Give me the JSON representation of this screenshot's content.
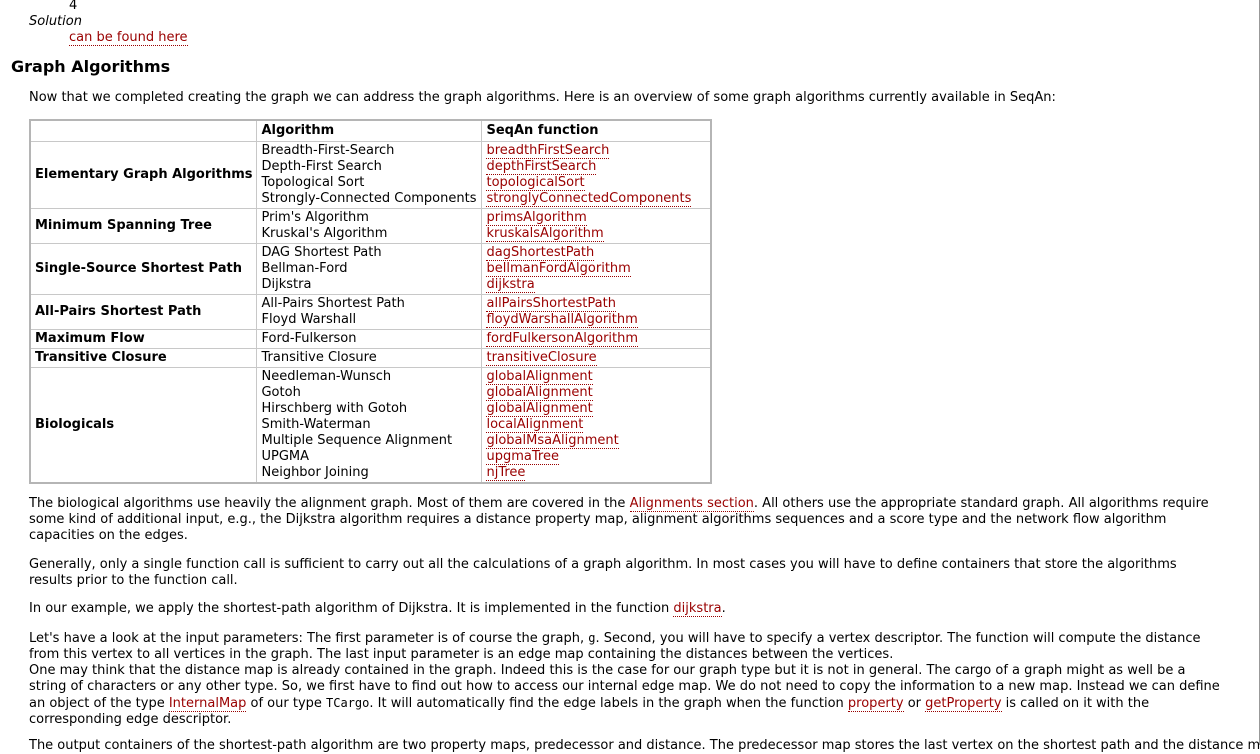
{
  "top_number": "4",
  "solution_label": "Solution",
  "solution_link": "can be found here",
  "section_title": "Graph Algorithms",
  "intro": "Now that we completed creating the graph we can address the graph algorithms. Here is an overview of some graph algorithms currently available in SeqAn:",
  "table": {
    "headers": [
      "",
      "Algorithm",
      "SeqAn function"
    ],
    "groups": [
      {
        "category": "Elementary Graph Algorithms",
        "rows": [
          {
            "algorithm": "Breadth-First-Search",
            "function": "breadthFirstSearch"
          },
          {
            "algorithm": "Depth-First Search",
            "function": "depthFirstSearch"
          },
          {
            "algorithm": "Topological Sort",
            "function": "topologicalSort"
          },
          {
            "algorithm": "Strongly-Connected Components",
            "function": "stronglyConnectedComponents"
          }
        ]
      },
      {
        "category": "Minimum Spanning Tree",
        "rows": [
          {
            "algorithm": "Prim's Algorithm",
            "function": "primsAlgorithm"
          },
          {
            "algorithm": "Kruskal's Algorithm",
            "function": "kruskalsAlgorithm"
          }
        ]
      },
      {
        "category": "Single-Source Shortest Path",
        "rows": [
          {
            "algorithm": "DAG Shortest Path",
            "function": "dagShortestPath"
          },
          {
            "algorithm": "Bellman-Ford",
            "function": "bellmanFordAlgorithm"
          },
          {
            "algorithm": "Dijkstra",
            "function": "dijkstra"
          }
        ]
      },
      {
        "category": "All-Pairs Shortest Path",
        "rows": [
          {
            "algorithm": "All-Pairs Shortest Path",
            "function": "allPairsShortestPath"
          },
          {
            "algorithm": "Floyd Warshall",
            "function": "floydWarshallAlgorithm"
          }
        ]
      },
      {
        "category": "Maximum Flow",
        "rows": [
          {
            "algorithm": "Ford-Fulkerson",
            "function": "fordFulkersonAlgorithm"
          }
        ]
      },
      {
        "category": "Transitive Closure",
        "rows": [
          {
            "algorithm": "Transitive Closure",
            "function": "transitiveClosure"
          }
        ]
      },
      {
        "category": "Biologicals",
        "rows": [
          {
            "algorithm": "Needleman-Wunsch",
            "function": "globalAlignment"
          },
          {
            "algorithm": "Gotoh",
            "function": "globalAlignment"
          },
          {
            "algorithm": "Hirschberg with Gotoh",
            "function": "globalAlignment"
          },
          {
            "algorithm": "Smith-Waterman",
            "function": "localAlignment"
          },
          {
            "algorithm": "Multiple Sequence Alignment",
            "function": "globalMsaAlignment"
          },
          {
            "algorithm": "UPGMA",
            "function": "upgmaTree"
          },
          {
            "algorithm": "Neighbor Joining",
            "function": "njTree"
          }
        ]
      }
    ]
  },
  "para1": {
    "before": "The biological algorithms use heavily the alignment graph. Most of them are covered in the ",
    "link": "Alignments section",
    "after": ". All others use the appropriate standard graph. All algorithms require some kind of additional input, e.g., the Dijkstra algorithm requires a distance property map, alignment algorithms sequences and a score type and the network flow algorithm capacities on the edges."
  },
  "para2": "Generally, only a single function call is sufficient to carry out all the calculations of a graph algorithm. In most cases you will have to define containers that store the algorithms results prior to the function call.",
  "para3": {
    "before": "In our example, we apply the shortest-path algorithm of Dijkstra. It is implemented in the function ",
    "link": "dijkstra",
    "after": "."
  },
  "para4": {
    "s1": "Let's have a look at the input parameters: The first parameter is of course the graph, ",
    "code1": "g",
    "s2": ". Second, you will have to specify a vertex descriptor. The function will compute the distance from this vertex to all vertices in the graph. The last input parameter is an edge map containing the distances between the vertices.",
    "s3": "One may think that the distance map is already contained in the graph. Indeed this is the case for our graph type but it is not in general. The cargo of a graph might as well be a string of characters or any other type. So, we first have to find out how to access our internal edge map. We do not need to copy the information to a new map. Instead we can define an object of the type ",
    "link1": "InternalMap",
    "s4": " of our type ",
    "code2": "TCargo",
    "s5": ". It will automatically find the edge labels in the graph when the function ",
    "link2": "property",
    "s6": " or ",
    "link3": "getProperty",
    "s7": " is called on it with the corresponding edge descriptor."
  },
  "para5_cut": "The output containers of the shortest-path algorithm are two property maps, predecessor and distance. The predecessor map stores the last vertex on the shortest path and the distance map stores"
}
